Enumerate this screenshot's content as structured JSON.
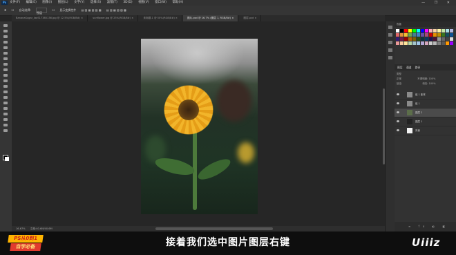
{
  "menubar": {
    "logo": "Ps",
    "items": [
      "文件(F)",
      "编辑(E)",
      "图像(I)",
      "图层(L)",
      "文字(Y)",
      "选择(S)",
      "滤镜(T)",
      "3D(D)",
      "视图(V)",
      "窗口(W)",
      "帮助(H)"
    ],
    "window_controls": "— ❐ ✕"
  },
  "optionbar": {
    "auto_select": "自动选择:",
    "target": "图层",
    "show_transform": "显示变换控件"
  },
  "tabs": [
    {
      "label": "BananaSugar_laaS17385136.jpg @ 12.5%(RGB/8#) ×",
      "active": false
    },
    {
      "label": "sunflower.jpg @ 25%(RGB/8#) ×",
      "active": false
    },
    {
      "label": "未标题-1 @ 50%(RGB/8#) ×",
      "active": false
    },
    {
      "label": "图片.psd @ 16.7% (图层 1, RGB/8#) ×",
      "active": true
    },
    {
      "label": "图层.psd ×",
      "active": false
    }
  ],
  "panels": {
    "swatches_title": "色板",
    "swatch_colors": [
      "#ffffff",
      "#000000",
      "#ff0000",
      "#ffff00",
      "#00ff00",
      "#00ffff",
      "#0000ff",
      "#ff00ff",
      "#f7b3b3",
      "#f9d3a5",
      "#fff4a3",
      "#c6e7a5",
      "#a6dbe3",
      "#b0b7e0",
      "#e06666",
      "#e69138",
      "#f1c232",
      "#6aa84f",
      "#45818e",
      "#3d85c6",
      "#674ea7",
      "#a64d79",
      "#cc0000",
      "#e69100",
      "#bf9000",
      "#38761d",
      "#134f5c",
      "#0b5394",
      "#351c75",
      "#741b47",
      "#990000",
      "#b45f06",
      "#7f6000",
      "#274e13",
      "#0c343d",
      "#073763",
      "#20124d",
      "#4c1130",
      "#999999",
      "#666666",
      "#434343",
      "#d9d9d9",
      "#ea9999",
      "#f9cb9c",
      "#ffe599",
      "#b6d7a8",
      "#a2c4c9",
      "#9fc5e8",
      "#b4a7d6",
      "#d5a6bd",
      "#cccccc",
      "#b7b7b7",
      "#7f7f7f",
      "#595959",
      "#ff9900",
      "#9900ff"
    ],
    "layers_tab": "图层",
    "channels_tab": "通道",
    "paths_tab": "路径",
    "kind": "类型",
    "blend_mode": "正常",
    "opacity_label": "不透明度:",
    "opacity_value": "100%",
    "lock_label": "锁定:",
    "fill_label": "填充:",
    "fill_value": "100%",
    "layers": [
      {
        "name": "组 1 副本",
        "thumb": "#8a8a8a",
        "selected": false
      },
      {
        "name": "组 1",
        "thumb": "#8a8a8a",
        "selected": false
      },
      {
        "name": "图层 2",
        "thumb": "#5c6e4a",
        "selected": true
      },
      {
        "name": "图层 1",
        "thumb": "#222222",
        "selected": false
      },
      {
        "name": "背景",
        "thumb": "#f2f2f2",
        "selected": false
      }
    ],
    "footer_icons": "∞ fx ◐ ◧ ▭ ▦ 🗑"
  },
  "statusbar": {
    "zoom": "16.67%",
    "doc": "文档:40.6M/40.6M"
  },
  "subtitle": "接着我们选中图片图层右键",
  "badge": {
    "line1": "PS从0到1",
    "line2": "自学必备"
  },
  "brand": "Uiiiz"
}
